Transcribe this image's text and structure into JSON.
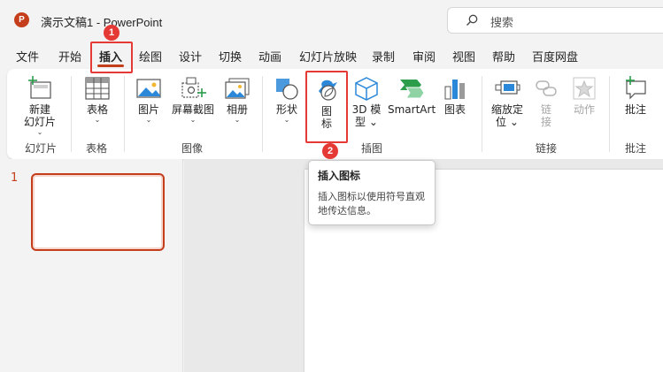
{
  "titlebar": {
    "logo_letter": "P",
    "doc_title": "演示文稿1  -  PowerPoint",
    "search_placeholder": "搜索"
  },
  "tabs": [
    {
      "label": "文件"
    },
    {
      "label": "开始"
    },
    {
      "label": "插入",
      "active": true
    },
    {
      "label": "绘图"
    },
    {
      "label": "设计"
    },
    {
      "label": "切换"
    },
    {
      "label": "动画"
    },
    {
      "label": "幻灯片放映"
    },
    {
      "label": "录制"
    },
    {
      "label": "审阅"
    },
    {
      "label": "视图"
    },
    {
      "label": "帮助"
    },
    {
      "label": "百度网盘"
    }
  ],
  "ribbon": {
    "new_slide": {
      "line1": "新建",
      "line2": "幻灯片"
    },
    "table": "表格",
    "picture": "图片",
    "screenshot": "屏幕截图",
    "album": "相册",
    "shapes": "形状",
    "icons": {
      "line1": "图",
      "line2": "标"
    },
    "model3d": {
      "line1": "3D 模",
      "line2": "型"
    },
    "smartart": "SmartArt",
    "chart": "图表",
    "zoom": {
      "line1": "缩放定",
      "line2": "位"
    },
    "link": {
      "line1": "链",
      "line2": "接"
    },
    "action": "动作",
    "comment": "批注",
    "groups": {
      "slides": "幻灯片",
      "tables": "表格",
      "images": "图像",
      "illustrations": "插图",
      "links": "链接",
      "comments": "批注"
    }
  },
  "slides": {
    "number": "1"
  },
  "tooltip": {
    "title": "插入图标",
    "body": "插入图标以使用符号直观地传达信息。"
  },
  "annotations": {
    "step1": "1",
    "step2": "2"
  },
  "colors": {
    "accent": "#c43e1c",
    "highlight": "#e53935",
    "icon_blue": "#2b88d8"
  }
}
